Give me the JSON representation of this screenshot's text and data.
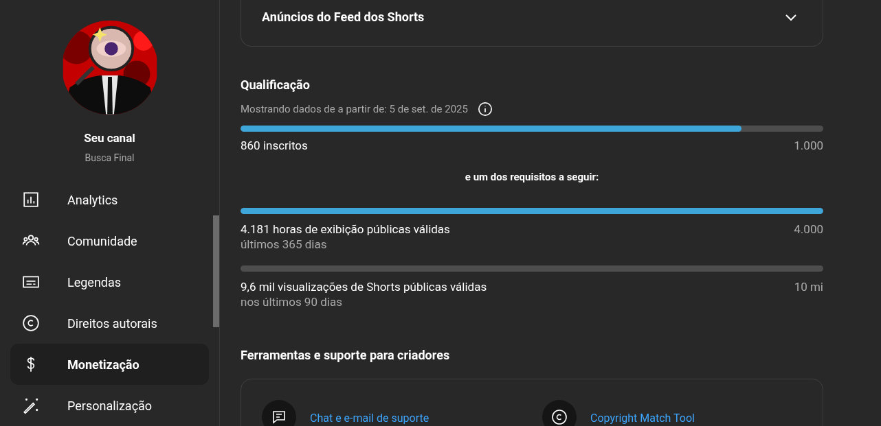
{
  "channel": {
    "title": "Seu canal",
    "name": "Busca Final"
  },
  "sidebar": {
    "items": [
      {
        "label": "Analytics",
        "selected": false
      },
      {
        "label": "Comunidade",
        "selected": false
      },
      {
        "label": "Legendas",
        "selected": false
      },
      {
        "label": "Direitos autorais",
        "selected": false
      },
      {
        "label": "Monetização",
        "selected": true
      },
      {
        "label": "Personalização",
        "selected": false
      }
    ]
  },
  "ads_section": {
    "title": "Anúncios do Feed dos Shorts",
    "expanded": false
  },
  "qualification": {
    "title": "Qualificação",
    "subtitle": "Mostrando dados de a partir de: 5 de set. de 2025",
    "subscribers": {
      "label": "860 inscritos",
      "target": "1.000",
      "level": 0.86
    },
    "separator": "e um dos requisitos a seguir:",
    "requirements": [
      {
        "label": "4.181 horas de exibição públicas válidas",
        "period": "últimos 365 dias",
        "target": "4.000",
        "level": 1
      },
      {
        "label": "9,6 mil visualizações de Shorts públicas válidas",
        "period": "nos últimos 90 dias",
        "target": "10 mi",
        "level": 0
      }
    ]
  },
  "tools": {
    "title": "Ferramentas e suporte para criadores",
    "links": [
      {
        "label": "Chat e e-mail de suporte"
      },
      {
        "label": "Copyright Match Tool"
      }
    ]
  }
}
